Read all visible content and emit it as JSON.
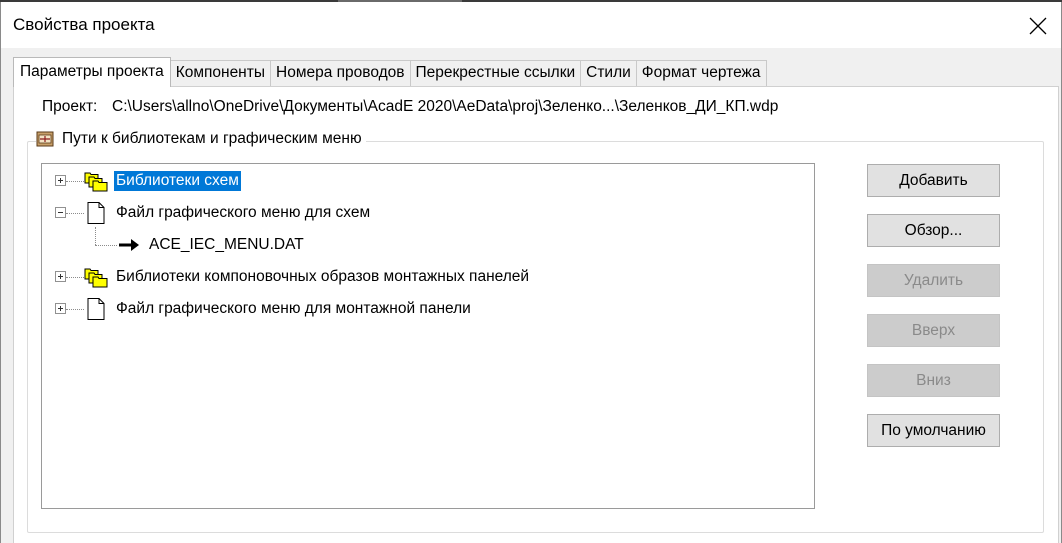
{
  "window": {
    "title": "Свойства проекта",
    "close_icon": "close-icon"
  },
  "tabs": [
    {
      "label": "Параметры проекта",
      "active": true
    },
    {
      "label": "Компоненты",
      "active": false
    },
    {
      "label": "Номера проводов",
      "active": false
    },
    {
      "label": "Перекрестные ссылки",
      "active": false
    },
    {
      "label": "Стили",
      "active": false
    },
    {
      "label": "Формат чертежа",
      "active": false
    }
  ],
  "project": {
    "label": "Проект:",
    "path": "C:\\Users\\allno\\OneDrive\\Документы\\AcadE 2020\\AeData\\proj\\Зеленко...\\Зеленков_ДИ_КП.wdp"
  },
  "library_group": {
    "title": "Пути к библиотекам и графическим меню",
    "icon": "library-icon"
  },
  "tree": {
    "items": [
      {
        "label": "Библиотеки схем",
        "icon": "folders-icon",
        "expander": "plus",
        "selected": true
      },
      {
        "label": "Файл графического меню для схем",
        "icon": "document-icon",
        "expander": "minus",
        "selected": false
      },
      {
        "label": "ACE_IEC_MENU.DAT",
        "icon": "arrow-right-icon",
        "expander": "none",
        "selected": false
      },
      {
        "label": "Библиотеки компоновочных образов монтажных панелей",
        "icon": "folders-icon",
        "expander": "plus",
        "selected": false
      },
      {
        "label": "Файл графического меню для монтажной панели",
        "icon": "document-icon",
        "expander": "plus",
        "selected": false
      }
    ]
  },
  "buttons": {
    "add": {
      "label": "Добавить",
      "enabled": true
    },
    "browse": {
      "label": "Обзор...",
      "enabled": true
    },
    "delete": {
      "label": "Удалить",
      "enabled": false
    },
    "up": {
      "label": "Вверх",
      "enabled": false
    },
    "down": {
      "label": "Вниз",
      "enabled": false
    },
    "default": {
      "label": "По умолчанию",
      "enabled": true
    }
  },
  "colors": {
    "selection": "#0078d7",
    "folder_yellow": "#ffff00",
    "disabled_text": "#8a8a8a"
  }
}
